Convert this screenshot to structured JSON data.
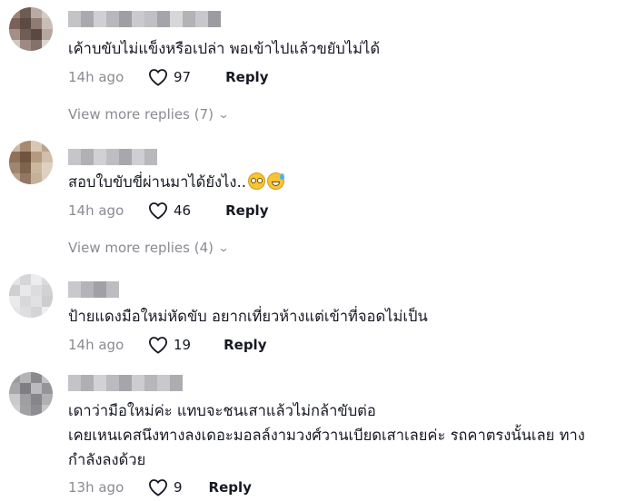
{
  "comments": [
    {
      "text_lines": [
        "เค้าบขับไม่แข็งหรือเปล่า พอเข้าไปแล้วขยับไม่ได้"
      ],
      "time": "14h ago",
      "likes": "97",
      "reply_label": "Reply",
      "view_more": "View more replies (7)",
      "avatar_colors": [
        "#9a8578",
        "#6e5b52",
        "#b9aba4",
        "#d3cdc9",
        "#7a6259",
        "#5d4a42",
        "#8f7b72",
        "#c8beb8",
        "#a38f86",
        "#6f5c54",
        "#5b4841",
        "#b5a79f",
        "#cfc8c3",
        "#9d8b83",
        "#84716a",
        "#dcd6d2"
      ],
      "username_colors": [
        "#c3c3c8",
        "#a9a9ae",
        "#d0d0d4",
        "#b7b7bc",
        "#9e9ea4",
        "#cacace",
        "#bfbfc4",
        "#a4a4aa",
        "#d7d7da",
        "#b2b2b7",
        "#c8c8cc",
        "#9b9ba1"
      ]
    },
    {
      "text_lines": [
        "สอบใบขับขี่ผ่านมาได้ยังไง.."
      ],
      "emojis": [
        "flushed-face-emoji",
        "grinning-sweat-emoji"
      ],
      "time": "14h ago",
      "likes": "46",
      "reply_label": "Reply",
      "view_more": "View more replies (4)",
      "avatar_colors": [
        "#cdb8a3",
        "#a68a72",
        "#d9c7b4",
        "#bda38c",
        "#8f7058",
        "#6f543f",
        "#b59a82",
        "#d2bea9",
        "#a08570",
        "#7e634d",
        "#cbb6a0",
        "#e0d0bf",
        "#b8a08a",
        "#937762",
        "#c5b09a",
        "#ddd0c2"
      ],
      "username_colors": [
        "#c5c5ca",
        "#b0b0b5",
        "#d1d1d5",
        "#bdbdc2",
        "#a7a7ad",
        "#cfcfd3",
        "#b8b8bd"
      ]
    },
    {
      "text_lines": [
        "ป้ายแดงมือใหม่หัดขับ อยากเที่ยวห้างแต่เข้าที่จอดไม่เป็น"
      ],
      "time": "14h ago",
      "likes": "19",
      "reply_label": "Reply",
      "avatar_colors": [
        "#e4e4e6",
        "#d6d6d9",
        "#ececee",
        "#dadadd",
        "#cfcfd2",
        "#e8e8ea",
        "#dcdcdf",
        "#d2d2d5",
        "#eaeaec",
        "#d8d8db",
        "#e1e1e3",
        "#cdcdd0",
        "#e6e6e8",
        "#dedee0",
        "#d4d4d7",
        "#efeff0"
      ],
      "username_colors": [
        "#c9c9cd",
        "#b3b3b8",
        "#a0a0a6",
        "#bcbcc1"
      ]
    },
    {
      "text_lines": [
        "เดาว่ามือใหม่ค่ะ แทบจะชนเสาแล้วไม่กล้าขับต่อ",
        "เคยเหนเคสนึงทางลงเดอะมอลล์งามวงศ์วานเบียดเสาเลยค่ะ รถคาตรงนั้นเลย ทาง",
        "กำลังลงด้วย"
      ],
      "time": "13h ago",
      "likes": "9",
      "reply_label": "Reply",
      "avatar_colors": [
        "#9c9c9f",
        "#b4b4b7",
        "#8a8a8e",
        "#c2c2c5",
        "#a7a7aa",
        "#7f7f83",
        "#bbbbbe",
        "#959599",
        "#cacacd",
        "#9f9fa3",
        "#85858a",
        "#b0b0b3",
        "#d0d0d2",
        "#a2a2a5",
        "#8d8d91",
        "#c6c6c8"
      ],
      "username_colors": [
        "#c4c4c8",
        "#afafb4",
        "#d2d2d6",
        "#bababf",
        "#a5a5ab",
        "#cdcdd1",
        "#b6b6bb",
        "#c9c9cd",
        "#acacb1"
      ]
    }
  ]
}
